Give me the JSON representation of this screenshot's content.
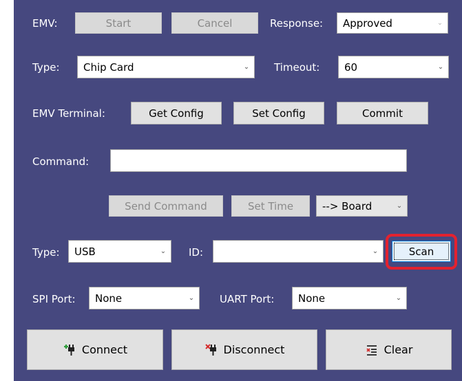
{
  "emv": {
    "label": "EMV:",
    "start_label": "Start",
    "cancel_label": "Cancel",
    "response_label": "Response:",
    "response_value": "Approved"
  },
  "card": {
    "type_label": "Type:",
    "type_value": "Chip Card",
    "timeout_label": "Timeout:",
    "timeout_value": "60"
  },
  "terminal": {
    "label": "EMV Terminal:",
    "get_config_label": "Get Config",
    "set_config_label": "Set Config",
    "commit_label": "Commit"
  },
  "command": {
    "label": "Command:",
    "value": "",
    "send_label": "Send Command",
    "set_time_label": "Set Time",
    "target_value": "--> Board"
  },
  "connection": {
    "type_label": "Type:",
    "type_value": "USB",
    "id_label": "ID:",
    "id_value": "",
    "scan_label": "Scan"
  },
  "ports": {
    "spi_label": "SPI Port:",
    "spi_value": "None",
    "uart_label": "UART Port:",
    "uart_value": "None"
  },
  "actions": {
    "connect_label": "Connect",
    "disconnect_label": "Disconnect",
    "clear_label": "Clear"
  },
  "colors": {
    "panel_bg": "#46487f",
    "highlight": "#e3222f",
    "connect_icon": "#2e9e3a",
    "disconnect_icon": "#d42b2b"
  },
  "icons": {
    "connect": "plug-plus-icon",
    "disconnect": "plug-x-icon",
    "clear": "clear-list-icon",
    "dropdown": "chevron-down-icon"
  }
}
